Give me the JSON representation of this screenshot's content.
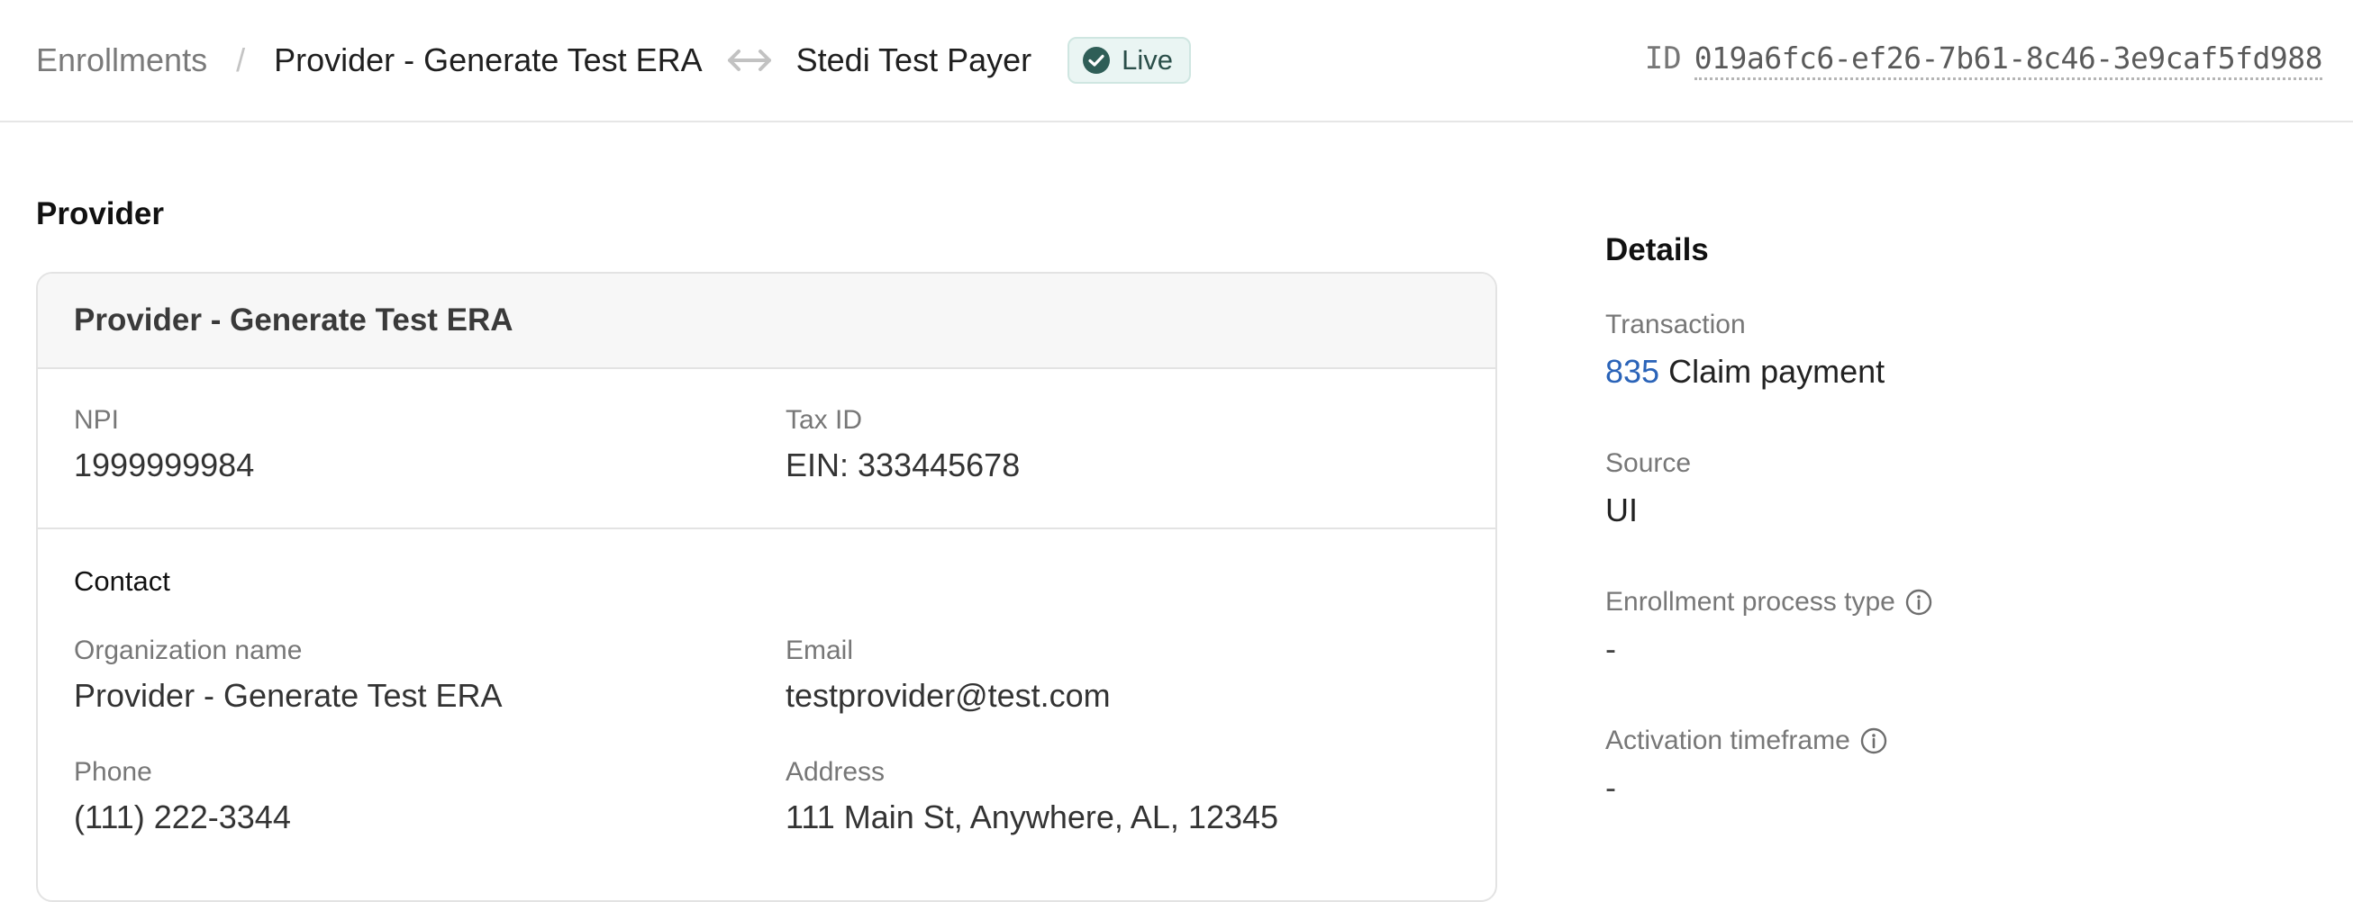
{
  "header": {
    "breadcrumb_root": "Enrollments",
    "separator": "/",
    "provider_name": "Provider - Generate Test ERA",
    "payer_name": "Stedi Test Payer",
    "status": "Live",
    "id_label": "ID",
    "id_value": "019a6fc6-ef26-7b61-8c46-3e9caf5fd988"
  },
  "provider": {
    "section_title": "Provider",
    "card_title": "Provider - Generate Test ERA",
    "npi_label": "NPI",
    "npi_value": "1999999984",
    "tax_label": "Tax ID",
    "tax_value": "EIN: 333445678",
    "contact": {
      "title": "Contact",
      "org_label": "Organization name",
      "org_value": "Provider - Generate Test ERA",
      "email_label": "Email",
      "email_value": "testprovider@test.com",
      "phone_label": "Phone",
      "phone_value": "(111) 222-3344",
      "address_label": "Address",
      "address_value": "111 Main St, Anywhere, AL, 12345"
    }
  },
  "details": {
    "title": "Details",
    "transaction_label": "Transaction",
    "transaction_code": "835",
    "transaction_name": "Claim payment",
    "source_label": "Source",
    "source_value": "UI",
    "process_label": "Enrollment process type",
    "process_value": "-",
    "timeframe_label": "Activation timeframe",
    "timeframe_value": "-"
  },
  "colors": {
    "accent_link": "#2a63b8",
    "live_badge_bg": "#eaf5f3",
    "live_check": "#2f5e57"
  },
  "icons": {
    "arrow": "bidirectional-arrow-icon",
    "status": "check-circle-icon",
    "info": "info-icon"
  }
}
